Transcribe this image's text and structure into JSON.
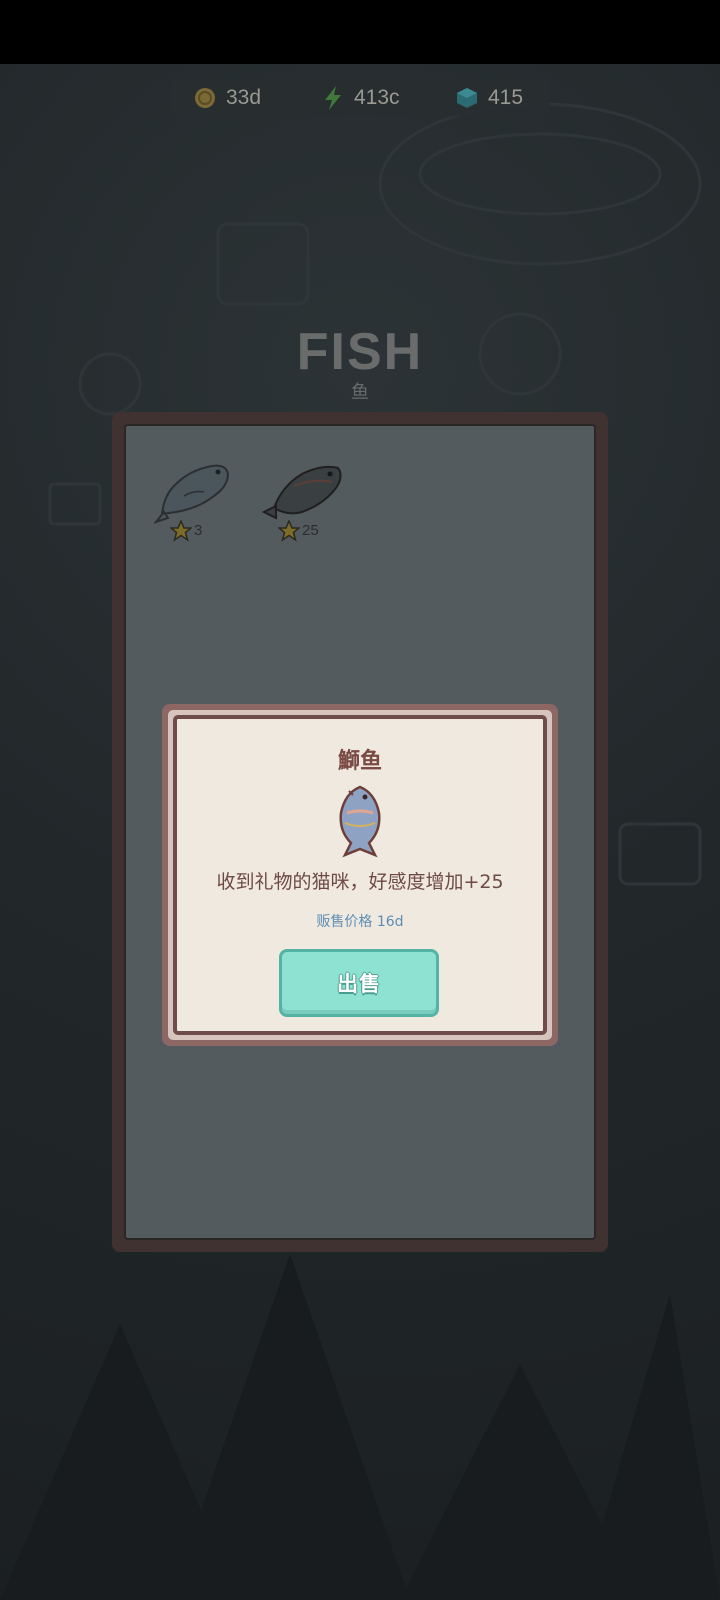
{
  "resources": {
    "coins": {
      "icon": "coin-icon",
      "value": "33d"
    },
    "energy": {
      "icon": "lightning-icon",
      "value": "413c"
    },
    "gems": {
      "icon": "gem-icon",
      "value": "415"
    }
  },
  "screen": {
    "title": "FISH",
    "subtitle": "鱼"
  },
  "inventory": {
    "items": [
      {
        "icon": "yellowtail-fish-icon",
        "count": "3"
      },
      {
        "icon": "flatfish-icon",
        "count": "25"
      }
    ]
  },
  "dialog": {
    "item_name": "鰤鱼",
    "item_icon": "yellowtail-fish-icon",
    "description": "收到礼物的猫咪，好感度增加+25",
    "price_label": "贩售价格 16d",
    "sell_label": "出售"
  },
  "colors": {
    "panel_border": "#3f3231",
    "panel_inner": "#535b5e",
    "dialog_bg": "#f0e9df",
    "sell_button": "#8ee2d2",
    "price_text": "#5e8db4",
    "name_text": "#7a4a44"
  }
}
